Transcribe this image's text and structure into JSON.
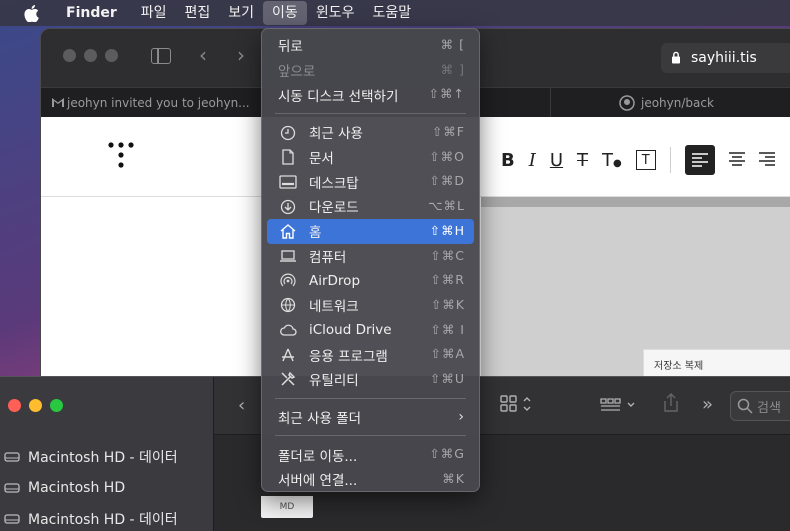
{
  "menubar": {
    "app": "Finder",
    "items": [
      "파일",
      "편집",
      "보기",
      "이동",
      "윈도우",
      "도움말"
    ]
  },
  "browser": {
    "url": "sayhiii.tis",
    "tabs": [
      "jeohyn invited you to jeohyn...",
      "jeohyn/back"
    ],
    "clone_button": "저장소 복제"
  },
  "go_menu": {
    "group1": [
      {
        "label": "뒤로",
        "shortcut": "⌘ [",
        "disabled": false
      },
      {
        "label": "앞으로",
        "shortcut": "⌘ ]",
        "disabled": true
      },
      {
        "label": "시동 디스크 선택하기",
        "shortcut": "⇧⌘↑",
        "disabled": false
      }
    ],
    "group2": [
      {
        "label": "최근 사용",
        "shortcut": "⇧⌘F",
        "icon": "clock-icon"
      },
      {
        "label": "문서",
        "shortcut": "⇧⌘O",
        "icon": "document-icon"
      },
      {
        "label": "데스크탑",
        "shortcut": "⇧⌘D",
        "icon": "desktop-icon"
      },
      {
        "label": "다운로드",
        "shortcut": "⌥⌘L",
        "icon": "download-icon"
      },
      {
        "label": "홈",
        "shortcut": "⇧⌘H",
        "icon": "home-icon",
        "highlighted": true
      },
      {
        "label": "컴퓨터",
        "shortcut": "⇧⌘C",
        "icon": "laptop-icon"
      },
      {
        "label": "AirDrop",
        "shortcut": "⇧⌘R",
        "icon": "airdrop-icon"
      },
      {
        "label": "네트워크",
        "shortcut": "⇧⌘K",
        "icon": "network-icon"
      },
      {
        "label": "iCloud Drive",
        "shortcut": "⇧⌘ I",
        "icon": "cloud-icon"
      },
      {
        "label": "응용 프로그램",
        "shortcut": "⇧⌘A",
        "icon": "apps-icon"
      },
      {
        "label": "유틸리티",
        "shortcut": "⇧⌘U",
        "icon": "tools-icon"
      }
    ],
    "recent_folders": "최근 사용 폴더",
    "group4": [
      {
        "label": "폴더로 이동...",
        "shortcut": "⇧⌘G"
      },
      {
        "label": "서버에 연결...",
        "shortcut": "⌘K"
      }
    ]
  },
  "finder": {
    "sidebar": [
      "Macintosh HD - 데이터",
      "Macintosh HD",
      "Macintosh HD - 데이터"
    ],
    "search_placeholder": "검색",
    "file_label": "MD"
  },
  "colors": {
    "highlight": "#3d74d8",
    "traffic_red": "#fe5f57",
    "traffic_yellow": "#febc2e",
    "traffic_green": "#28c840"
  }
}
